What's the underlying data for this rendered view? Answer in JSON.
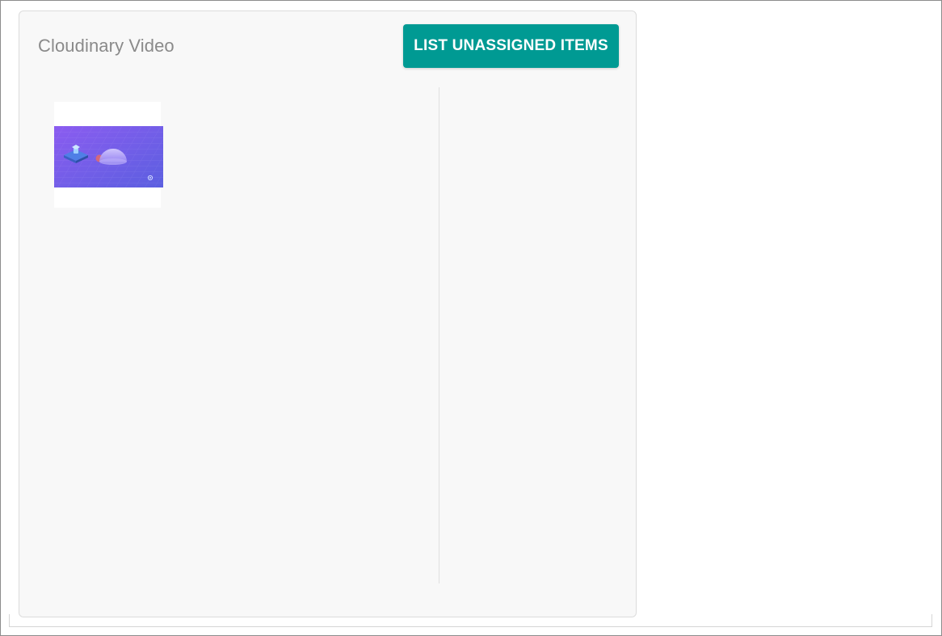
{
  "panel": {
    "title": "Cloudinary Video",
    "list_button_label": "LIST UNASSIGNED ITEMS"
  },
  "assets": [
    {
      "type": "video-thumbnail",
      "thumbnail_icon": "video-thumbnail-icon"
    }
  ],
  "colors": {
    "button_bg": "#009a93",
    "button_text": "#ffffff",
    "title_text": "#8a8a8a",
    "panel_bg": "#f8f8f8",
    "thumbnail_gradient_start": "#8b5cf0",
    "thumbnail_gradient_end": "#5b5fe0"
  }
}
